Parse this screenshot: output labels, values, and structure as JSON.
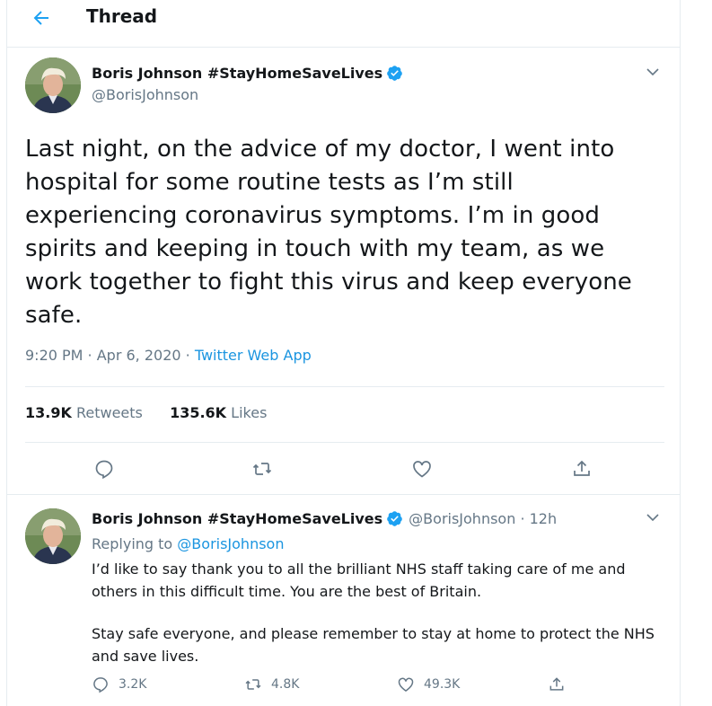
{
  "header": {
    "title": "Thread",
    "back_icon": "arrow-left-icon"
  },
  "colors": {
    "accent": "#1da1f2",
    "link": "#1b95e0",
    "muted": "#657786",
    "border": "#e6ecf0"
  },
  "main_tweet": {
    "author_name": "Boris Johnson #StayHomeSaveLives",
    "handle": "@BorisJohnson",
    "text": "Last night, on the advice of my doctor, I went into hospital for some routine tests as I’m still experiencing coronavirus symptoms. I’m in good spirits and keeping in touch with my team, as we work together to fight this virus and keep everyone safe.",
    "time": "9:20 PM · Apr 6, 2020 · ",
    "source": "Twitter Web App",
    "retweets_count": "13.9K",
    "retweets_label": "Retweets",
    "likes_count": "135.6K",
    "likes_label": "Likes"
  },
  "reply_tweet": {
    "author_name": "Boris Johnson #StayHomeSaveLives",
    "handle_time": "@BorisJohnson · 12h",
    "replying_prefix": "Replying to ",
    "replying_to": "@BorisJohnson",
    "paragraph1": "I’d like to say thank you to all the brilliant NHS staff taking care of me and others in this difficult time. You are the best of Britain.",
    "paragraph2": "Stay safe everyone, and please remember to stay at home to protect the NHS and save lives.",
    "reply_count": "3.2K",
    "retweet_count": "4.8K",
    "like_count": "49.3K"
  }
}
